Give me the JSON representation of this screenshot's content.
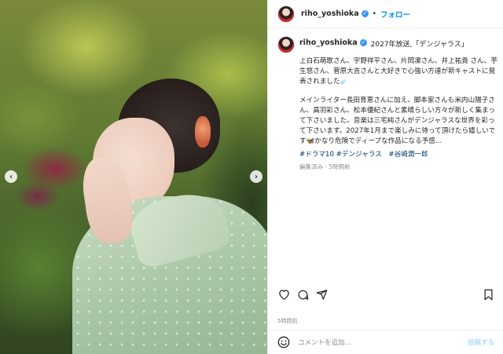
{
  "post": {
    "username": "riho_yoshioka",
    "follow_label": "フォロー",
    "dot": "•",
    "verified_icon": "verified-badge-icon",
    "caption_title": "2027年放送,「デンジャラス」",
    "caption_p1": "上白石萌歌さん、宇野祥平さん、片岡凜さん、井上祐貴 さん、芋生悠さん、菅原大吉さんと大好きで心強い方達が新キャストに発表されました☄️",
    "caption_p2": "メインライター長田育恵さんに加え、脚本家さんも米内山陽子さん、高羽彩さん、松本優紀さんと素晴らしい方々が新しく集まって下さいました。音楽は三宅純さんがデンジャラスな世界を彩って下さいます。2027年1月まで楽しみに待って頂けたら嬉しいです🦋かなり危険でディープな作品になる予感...",
    "hashtags": "#ドラマ10 #デンジャラス　#谷崎潤一郎",
    "meta": "編集済み · 5時間前",
    "time_ago": "5時間前",
    "comment_placeholder": "コメントを追加...",
    "post_button": "投稿する",
    "accent": "#0095f6"
  },
  "carousel": {
    "prev": "‹",
    "next": "›"
  }
}
